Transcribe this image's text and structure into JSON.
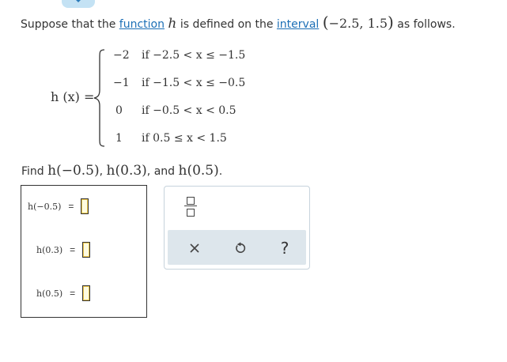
{
  "prompt": {
    "text_before": "Suppose that the ",
    "function_link": "function",
    "var": "h",
    "text_mid": " is defined on the ",
    "interval_link": "interval",
    "interval_open": "(",
    "interval_a": "−2.5, ",
    "interval_b": "1.5",
    "interval_close": ")",
    "text_after": " as follows."
  },
  "definition": {
    "lhs": "h (x) =",
    "cases": [
      {
        "value": "−2",
        "condition": "if −2.5 < x ≤ −1.5"
      },
      {
        "value": "−1",
        "condition": "if −1.5 < x ≤ −0.5"
      },
      {
        "value": "0",
        "condition": "if −0.5 < x < 0.5"
      },
      {
        "value": "1",
        "condition": "if 0.5 ≤ x < 1.5"
      }
    ]
  },
  "find": {
    "prefix": "Find ",
    "item1": "h(−0.5)",
    "sep1": ", ",
    "item2": "h(0.3)",
    "sep2": ", and ",
    "item3": "h(0.5)",
    "suffix": "."
  },
  "answers": [
    {
      "label": "h(−0.5)",
      "equals": "=",
      "value": ""
    },
    {
      "label": "h(0.3)",
      "equals": "=",
      "value": ""
    },
    {
      "label": "h(0.5)",
      "equals": "=",
      "value": ""
    }
  ],
  "toolbar": {
    "clear_symbol": "×",
    "help_symbol": "?"
  },
  "colors": {
    "link": "#1c6fb6",
    "tab": "#c4e2f4",
    "action_bar": "#dde6ec"
  }
}
